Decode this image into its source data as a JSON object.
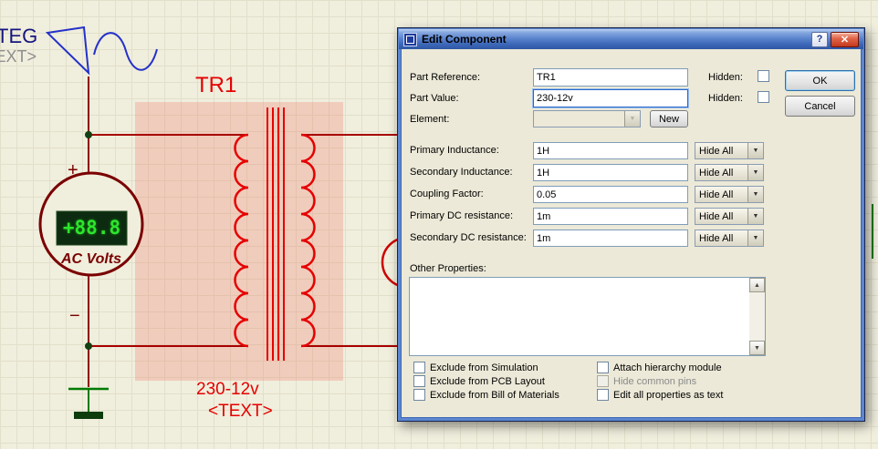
{
  "schematic": {
    "generator": {
      "label": "TEG",
      "text": "<TEXT>"
    },
    "transformer": {
      "ref": "TR1",
      "value": "230-12v",
      "text": "<TEXT>"
    },
    "voltmeter": {
      "reading": "+88.8",
      "label": "AC Volts",
      "plus": "+",
      "minus": "−"
    }
  },
  "dialog": {
    "title": "Edit Component",
    "help_glyph": "?",
    "close_glyph": "✕",
    "rows": [
      {
        "label": "Part Reference:",
        "value": "TR1",
        "hidden_label": "Hidden:"
      },
      {
        "label": "Part Value:",
        "value": "230-12v",
        "hidden_label": "Hidden:"
      }
    ],
    "element": {
      "label": "Element:",
      "value": "",
      "new_label": "New"
    },
    "params": [
      {
        "label": "Primary Inductance:",
        "value": "1H",
        "visibility": "Hide All"
      },
      {
        "label": "Secondary Inductance:",
        "value": "1H",
        "visibility": "Hide All"
      },
      {
        "label": "Coupling Factor:",
        "value": "0.05",
        "visibility": "Hide All"
      },
      {
        "label": "Primary DC resistance:",
        "value": "1m",
        "visibility": "Hide All"
      },
      {
        "label": "Secondary DC resistance:",
        "value": "1m",
        "visibility": "Hide All"
      }
    ],
    "other_properties_label": "Other Properties:",
    "checks_left": [
      "Exclude from Simulation",
      "Exclude from PCB Layout",
      "Exclude from Bill of Materials"
    ],
    "checks_right": [
      "Attach hierarchy module",
      "Hide common pins",
      "Edit all properties as text"
    ],
    "ok_label": "OK",
    "cancel_label": "Cancel",
    "combo_arrow": "▼",
    "scroll_up": "▲",
    "scroll_down": "▼"
  },
  "colors": {
    "component_red": "#e60000",
    "wire_maroon": "#8f0000",
    "ground_green": "#007a00",
    "display_green": "#2de52d",
    "selection_highlight": "#f0584a"
  }
}
